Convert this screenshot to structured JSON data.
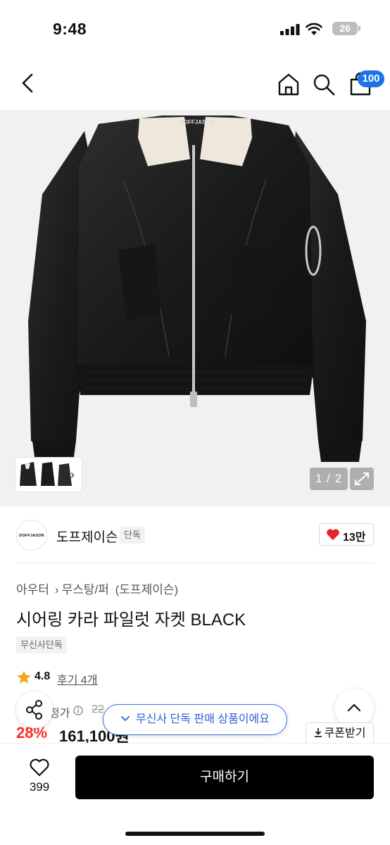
{
  "status_bar": {
    "time": "9:48",
    "battery": "26"
  },
  "header": {
    "cart_count": "100"
  },
  "gallery": {
    "counter": "1 / 2",
    "jacket_brand_label": "DOFFJASON"
  },
  "brand": {
    "logo_text": "DOFFJASON",
    "name": "도프제이슨",
    "badge": "단독"
  },
  "like": {
    "count": "13만"
  },
  "breadcrumb": {
    "items": [
      "아우터",
      "무스탕/퍼",
      "(도프제이슨)"
    ]
  },
  "product": {
    "title": "시어링 카라 파일럿 자켓 BLACK",
    "tag": "무신사단독"
  },
  "rating": {
    "value": "4.8",
    "reviews": "후기 4개"
  },
  "price": {
    "label": "정가",
    "original": "22",
    "discount": "28%",
    "sale": "161,100원"
  },
  "toast": {
    "message": "무신사 단독 판매 상품이에요"
  },
  "coupon": {
    "label": "쿠폰받기"
  },
  "bottom": {
    "wish_count": "399",
    "buy_label": "구매하기"
  },
  "colors": {
    "accent_blue": "#1a73e8",
    "discount_red": "#ff2b2b",
    "buy_black": "#000000"
  },
  "icons": [
    "back-icon",
    "home-icon",
    "search-icon",
    "cart-icon",
    "expand-icon",
    "heart-icon",
    "star-icon",
    "info-icon",
    "share-icon",
    "chevron-up-icon",
    "download-icon",
    "check-icon"
  ]
}
